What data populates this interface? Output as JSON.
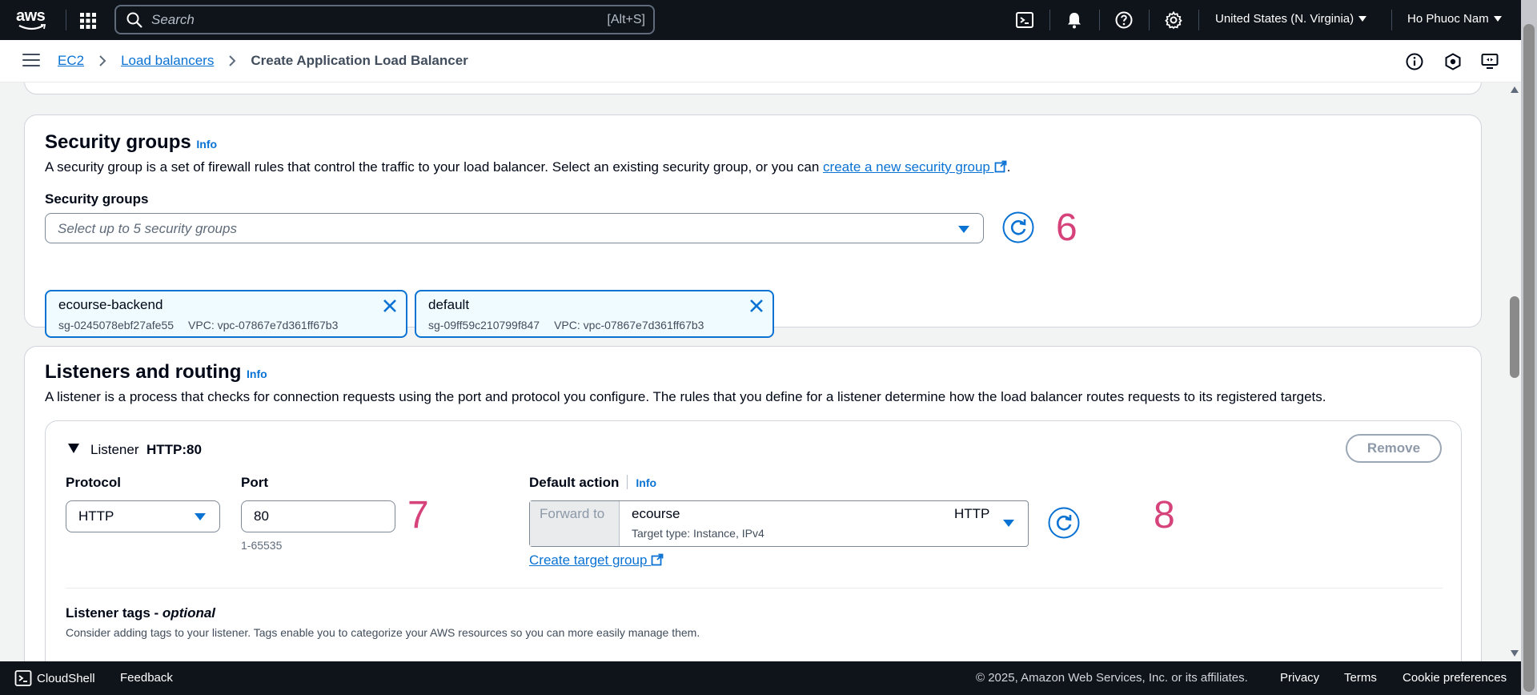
{
  "topnav": {
    "logo_text": "aws",
    "search_placeholder": "Search",
    "search_shortcut": "[Alt+S]",
    "region": "United States (N. Virginia)",
    "user": "Ho Phuoc Nam"
  },
  "breadcrumb": {
    "items": [
      "EC2",
      "Load balancers"
    ],
    "current": "Create Application Load Balancer"
  },
  "security_groups": {
    "title": "Security groups",
    "info": "Info",
    "description_pre": "A security group is a set of firewall rules that control the traffic to your load balancer. Select an existing security group, or you can ",
    "description_link": "create a new security group",
    "description_post": ".",
    "field_label": "Security groups",
    "select_placeholder": "Select up to 5 security groups",
    "annotation": "6",
    "tokens": [
      {
        "name": "ecourse-backend",
        "id": "sg-0245078ebf27afe55",
        "vpc": "VPC: vpc-07867e7d361ff67b3"
      },
      {
        "name": "default",
        "id": "sg-09ff59c210799f847",
        "vpc": "VPC: vpc-07867e7d361ff67b3"
      }
    ]
  },
  "listeners": {
    "title": "Listeners and routing",
    "info": "Info",
    "description": "A listener is a process that checks for connection requests using the port and protocol you configure. The rules that you define for a listener determine how the load balancer routes requests to its registered targets.",
    "listener": {
      "label": "Listener",
      "name": "HTTP:80",
      "remove": "Remove",
      "protocol_label": "Protocol",
      "protocol_value": "HTTP",
      "port_label": "Port",
      "port_value": "80",
      "port_hint": "1-65535",
      "annotation_port": "7",
      "default_action_label": "Default action",
      "default_action_info": "Info",
      "forward_label": "Forward to",
      "target_group": "ecourse",
      "target_type": "Target type: Instance, IPv4",
      "target_protocol": "HTTP",
      "create_target_group": "Create target group",
      "annotation_action": "8",
      "tags_label": "Listener tags - ",
      "tags_optional": "optional",
      "tags_description": "Consider adding tags to your listener. Tags enable you to categorize your AWS resources so you can more easily manage them."
    }
  },
  "footer": {
    "cloudshell": "CloudShell",
    "feedback": "Feedback",
    "copyright": "© 2025, Amazon Web Services, Inc. or its affiliates.",
    "privacy": "Privacy",
    "terms": "Terms",
    "cookies": "Cookie preferences"
  },
  "colors": {
    "link": "#0972d3",
    "annotation": "#d6437b",
    "nav_bg": "#0f141a"
  }
}
